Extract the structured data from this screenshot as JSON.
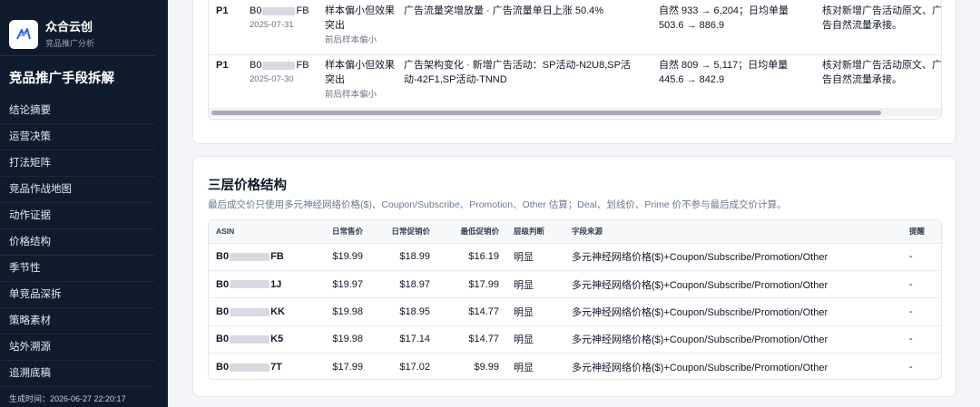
{
  "brand": {
    "name": "众合云创",
    "subtitle": "竞品推广分析"
  },
  "sidebar": {
    "title": "竞品推广手段拆解",
    "items": [
      "结论摘要",
      "运营决策",
      "打法矩阵",
      "竞品作战地图",
      "动作证据",
      "价格结构",
      "季节性",
      "单竞品深拆",
      "策略素材",
      "站外溯源",
      "追溯底稿"
    ],
    "generated": "生成时间：2026-06-27 22:20:17"
  },
  "top_rows": [
    {
      "priority": "P1",
      "asin_prefix": "B0",
      "asin_suffix": "FB",
      "date": "2025-07-31",
      "tag": "样本偏小但效果突出",
      "tag_sub": "前后样本偏小",
      "desc": "广告流量突增放量 · 广告流量单日上涨 50.4%",
      "effect": "自然 933 → 6,204；日均单量 503.6 → 886.9",
      "note": "核对新增广告活动原文、广告自然流量承接。"
    },
    {
      "priority": "P1",
      "asin_prefix": "B0",
      "asin_suffix": "FB",
      "date": "2025-07-30",
      "tag": "样本偏小但效果突出",
      "tag_sub": "前后样本偏小",
      "desc": "广告架构变化 · 新增广告活动：SP活动-N2U8,SP活动-42F1,SP活动-TNND",
      "effect": "自然 809 → 5,117；日均单量 445.6 → 842.9",
      "note": "核对新增广告活动原文、广告自然流量承接。"
    }
  ],
  "price_section": {
    "title": "三层价格结构",
    "description": "最后成交价只使用多元神经网络价格($)、Coupon/Subscribe、Promotion、Other 估算；Deal、划线价、Prime 价不参与最后成交价计算。",
    "headers": [
      "ASIN",
      "日常售价",
      "日常促销价",
      "最低促销价",
      "层级判断",
      "字段来源",
      "提醒"
    ],
    "rows": [
      {
        "asin_prefix": "B0",
        "asin_suffix": "FB",
        "daily": "$19.99",
        "promo": "$18.99",
        "lowest": "$16.19",
        "level": "明显",
        "source": "多元神经网络价格($)+Coupon/Subscribe/Promotion/Other",
        "alert": "-"
      },
      {
        "asin_prefix": "B0",
        "asin_suffix": "1J",
        "daily": "$19.97",
        "promo": "$18.97",
        "lowest": "$17.99",
        "level": "明显",
        "source": "多元神经网络价格($)+Coupon/Subscribe/Promotion/Other",
        "alert": "-"
      },
      {
        "asin_prefix": "B0",
        "asin_suffix": "KK",
        "daily": "$19.98",
        "promo": "$18.95",
        "lowest": "$14.77",
        "level": "明显",
        "source": "多元神经网络价格($)+Coupon/Subscribe/Promotion/Other",
        "alert": "-"
      },
      {
        "asin_prefix": "B0",
        "asin_suffix": "K5",
        "daily": "$19.98",
        "promo": "$17.14",
        "lowest": "$14.77",
        "level": "明显",
        "source": "多元神经网络价格($)+Coupon/Subscribe/Promotion/Other",
        "alert": "-"
      },
      {
        "asin_prefix": "B0",
        "asin_suffix": "7T",
        "daily": "$17.99",
        "promo": "$17.02",
        "lowest": "$9.99",
        "level": "明显",
        "source": "多元神经网络价格($)+Coupon/Subscribe/Promotion/Other",
        "alert": "-"
      }
    ]
  }
}
